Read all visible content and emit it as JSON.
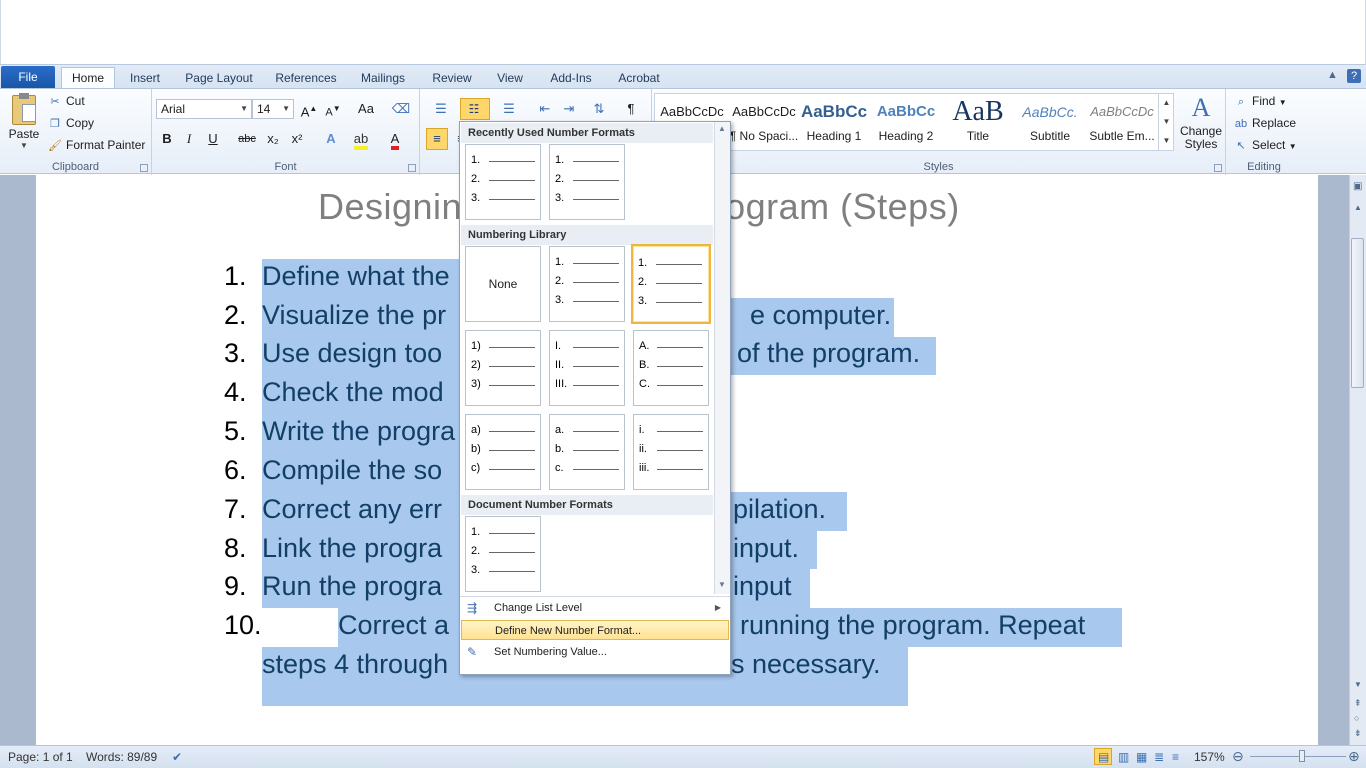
{
  "tabs": {
    "file": "File",
    "home": "Home",
    "insert": "Insert",
    "page_layout": "Page Layout",
    "references": "References",
    "mailings": "Mailings",
    "review": "Review",
    "view": "View",
    "add_ins": "Add-Ins",
    "acrobat": "Acrobat"
  },
  "clipboard": {
    "paste": "Paste",
    "cut": "Cut",
    "copy": "Copy",
    "format_painter": "Format Painter",
    "label": "Clipboard"
  },
  "font": {
    "family": "Arial",
    "size": "14",
    "label": "Font",
    "bold": "B",
    "italic": "I",
    "underline": "U",
    "strike": "abc",
    "subscript": "x₂",
    "superscript": "x²",
    "grow": "A",
    "shrink": "A",
    "change_case": "Aa",
    "font_color": "A"
  },
  "styles": {
    "label": "Styles",
    "items": [
      {
        "sample": "AaBbCcDc",
        "name": ""
      },
      {
        "sample": "AaBbCcDc",
        "name": "¶ No Spaci..."
      },
      {
        "sample": "AaBbCc",
        "name": "Heading 1"
      },
      {
        "sample": "AaBbCc",
        "name": "Heading 2"
      },
      {
        "sample": "AaB",
        "name": "Title"
      },
      {
        "sample": "AaBbCc.",
        "name": "Subtitle"
      },
      {
        "sample": "AaBbCcDc",
        "name": "Subtle Em..."
      }
    ],
    "change_styles": "Change",
    "change_styles_2": "Styles"
  },
  "editing": {
    "label": "Editing",
    "find": "Find",
    "replace": "Replace",
    "select": "Select"
  },
  "document": {
    "title": "Designing a Program (Steps)",
    "title_visible_left": "Designin",
    "title_visible_right": "a Program (Steps)",
    "items": [
      {
        "num": "1.",
        "text": "Define what the"
      },
      {
        "num": "2.",
        "text": "Visualize the pr"
      },
      {
        "num": "3.",
        "text": "Use design too"
      },
      {
        "num": "4.",
        "text": "Check the mod"
      },
      {
        "num": "5.",
        "text": "Write the progra"
      },
      {
        "num": "6.",
        "text": "Compile the so"
      },
      {
        "num": "7.",
        "text": "Correct any err"
      },
      {
        "num": "8.",
        "text": "Link the progra"
      },
      {
        "num": "9.",
        "text": "Run the progra"
      },
      {
        "num": "10.",
        "text": "Correct a"
      }
    ],
    "right_fragments": [
      {
        "line": 2,
        "text": "e computer."
      },
      {
        "line": 3,
        "text": "of the program."
      },
      {
        "line": 7,
        "text": "pilation."
      },
      {
        "line": 8,
        "text": "input."
      },
      {
        "line": 9,
        "text": "input"
      },
      {
        "line": 10,
        "text": "running the program. Repeat"
      }
    ],
    "line11_left": "steps 4 through",
    "line11_right": "s necessary."
  },
  "dropdown": {
    "recent_header": "Recently Used Number Formats",
    "library_header": "Numbering Library",
    "document_header": "Document Number Formats",
    "none_label": "None",
    "change_list_level": "Change List Level",
    "define_new": "Define New Number Format...",
    "set_value": "Set Numbering Value...",
    "formats": {
      "decimal": [
        "1.",
        "2.",
        "3."
      ],
      "paren": [
        "1)",
        "2)",
        "3)"
      ],
      "roman": [
        "I.",
        "II.",
        "III."
      ],
      "upper_alpha": [
        "A.",
        "B.",
        "C."
      ],
      "lower_alpha_paren": [
        "a)",
        "b)",
        "c)"
      ],
      "lower_alpha": [
        "a.",
        "b.",
        "c."
      ],
      "lower_roman": [
        "i.",
        "ii.",
        "iii."
      ]
    }
  },
  "status": {
    "page": "Page: 1 of 1",
    "words": "Words: 89/89",
    "zoom": "157%"
  },
  "colors": {
    "selection": "#a9c8ee",
    "accent": "#1a56a8",
    "hover": "#ffe293"
  }
}
